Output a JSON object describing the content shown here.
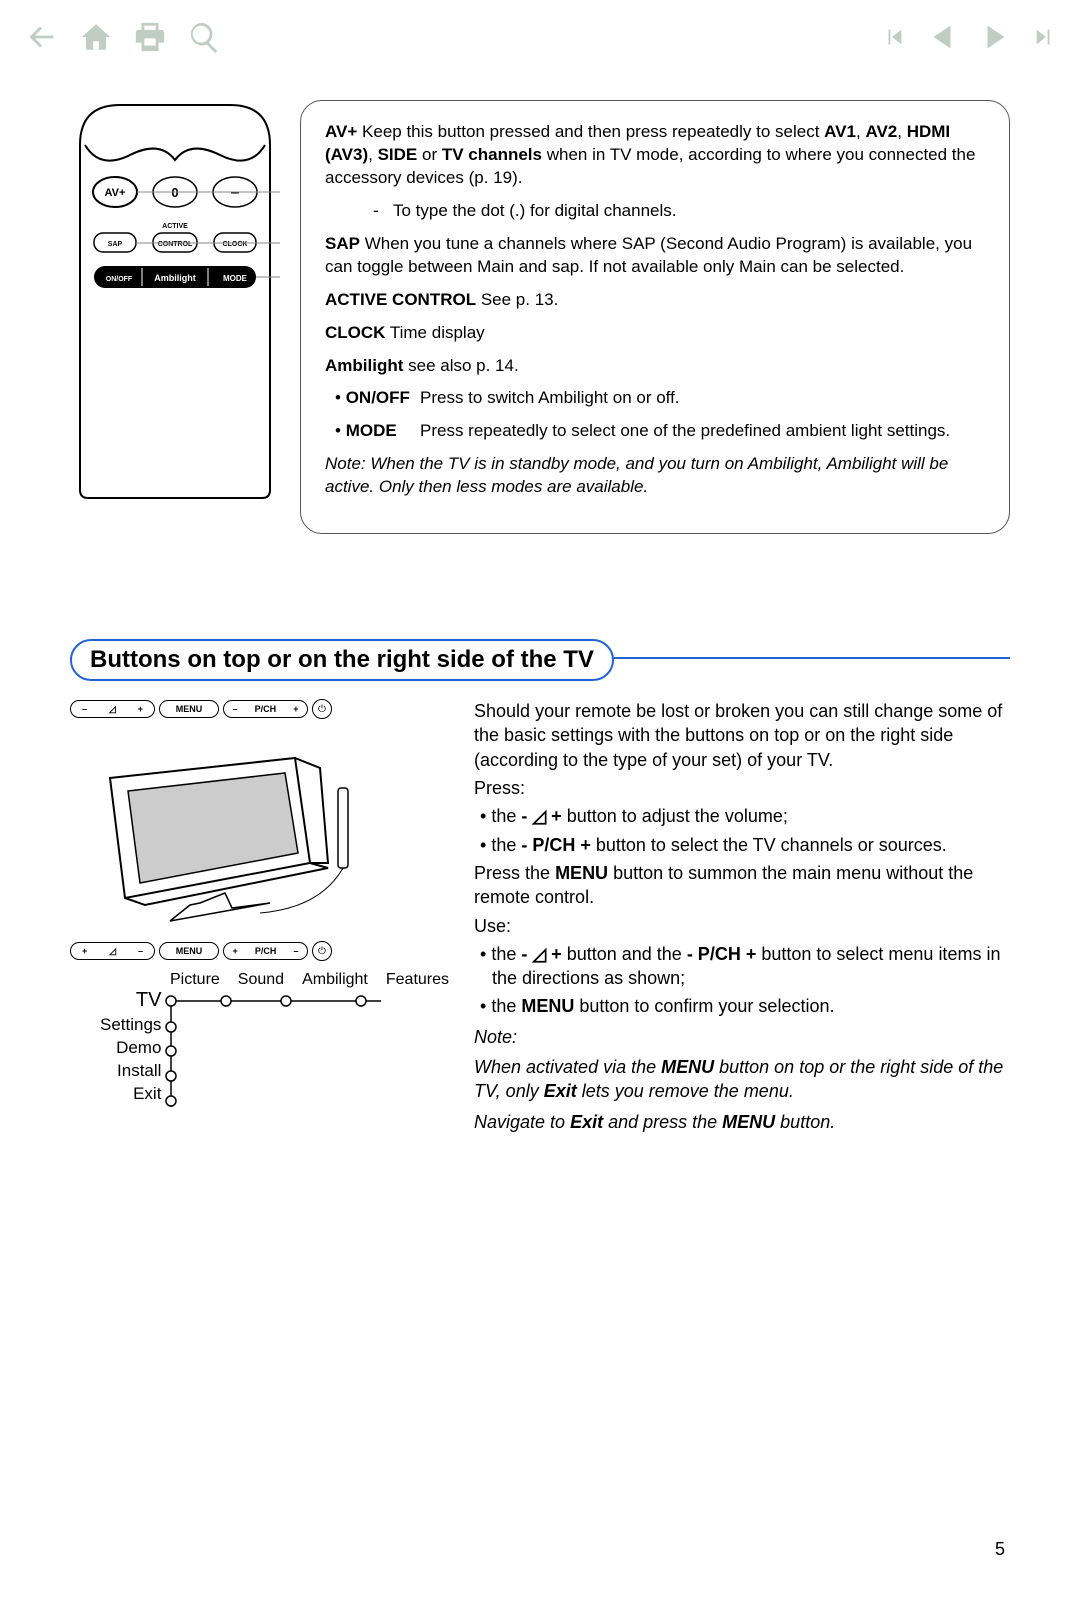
{
  "page_number": "5",
  "remote": {
    "buttons": [
      "AV+",
      "0",
      "–"
    ],
    "active_label": "ACTIVE",
    "row2": [
      "SAP",
      "CONTROL",
      "CLOCK"
    ],
    "row3": [
      "ON/OFF",
      "Ambilight",
      "MODE"
    ]
  },
  "desc": {
    "av_label": "AV+",
    "av_text_pre": "Keep this button pressed and then press repeatedly to select ",
    "av_bold1": "AV1",
    "av_bold2": "AV2",
    "av_bold3": "HDMI (AV3)",
    "av_bold4": "SIDE",
    "av_bold5": "TV channels",
    "av_text_post": " when in TV mode, according to where you connected the accessory devices (p. 19).",
    "dash_text": "To type the dot (.) for digital channels.",
    "sap_label": "SAP",
    "sap_text": "When you tune a channels where SAP (Second Audio Program) is available, you can toggle between Main and sap. If not available only Main can be selected.",
    "active_ctrl_label": "ACTIVE CONTROL",
    "active_ctrl_text": "  See p. 13.",
    "clock_label": "CLOCK",
    "clock_text": "  Time display",
    "ambi_label": "Ambilight",
    "ambi_text": "  see also p. 14.",
    "onoff_label": "ON/OFF",
    "onoff_text": "Press to switch Ambilight on or off.",
    "mode_label": "MODE",
    "mode_text": "Press repeatedly to select one of the predefined ambient light settings.",
    "note": "Note: When the TV is in standby mode, and you turn on Ambilight, Ambilight will be active. Only then less modes are available."
  },
  "section2_title": "Buttons on top or on the right side of the TV",
  "tv_diagram": {
    "bar_menu": "MENU",
    "bar_pch": "P/CH",
    "menu_cols": [
      "Picture",
      "Sound",
      "Ambilight",
      "Features"
    ],
    "menu_rows": [
      "TV",
      "Settings",
      "Demo",
      "Install",
      "Exit"
    ]
  },
  "right_col": {
    "intro": "Should your remote be lost or broken you can still change some of the basic settings with the buttons on top or on the right side (according to the type of your set) of your TV.",
    "press": "Press:",
    "b1_pre": "• the ",
    "b1_mid": " button to adjust the volume;",
    "b2_pre": "• the ",
    "b2_bold": "- P/CH +",
    "b2_post": " button to select the TV channels or sources.",
    "menu_p_pre": "Press the ",
    "menu_bold": "MENU",
    "menu_p_post": " button to summon the main menu without the remote control.",
    "use": "Use:",
    "u1_pre": "• the ",
    "u1_mid": " button and the ",
    "u1_bold2": "- P/CH +",
    "u1_post": " button to select menu items in the directions as shown;",
    "u2_pre": "• the ",
    "u2_post": " button to confirm your selection.",
    "note_label": "Note:",
    "note1_pre": "When activated via the ",
    "note1_bold": "MENU",
    "note1_mid": " button on top or the right side of the TV, only ",
    "note1_bold2": "Exit",
    "note1_post": " lets you remove the menu.",
    "note2_pre": "Navigate to ",
    "note2_bold": "Exit",
    "note2_mid": " and press the ",
    "note2_bold2": "MENU",
    "note2_post": " button."
  }
}
